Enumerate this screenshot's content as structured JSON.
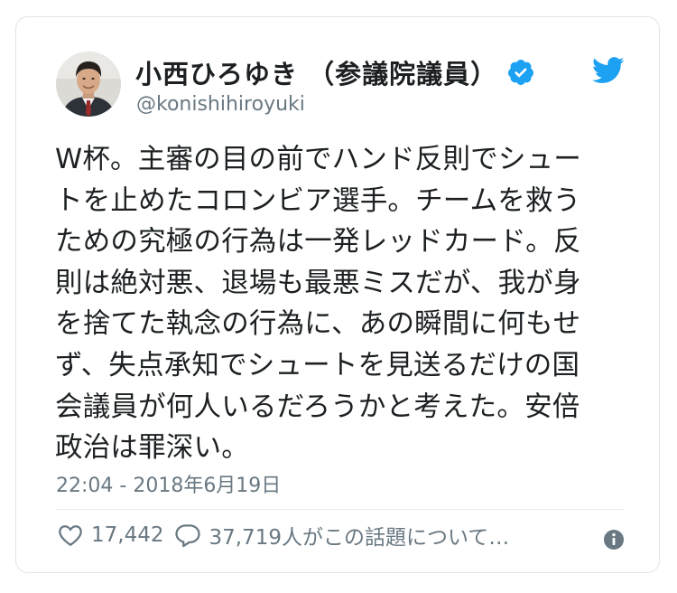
{
  "user": {
    "display_name": "小西ひろゆき （参議院議員）",
    "handle": "@konishihiroyuki",
    "avatar": "avatar-photo"
  },
  "tweet": {
    "lines": [
      "W杯。主審の目の前でハンド反則でシュー",
      "トを止めたコロンビア選手。チームを救う",
      "ための究極の行為は一発レッドカード。反",
      "則は絶対悪、退場も最悪ミスだが、我が身",
      "を捨てた執念の行為に、あの瞬間に何もせ",
      "ず、失点承知でシュートを見送るだけの国",
      "会議員が何人いるだろうかと考えた。安倍",
      "政治は罪深い。"
    ],
    "timestamp": "22:04 - 2018年6月19日"
  },
  "actions": {
    "likes": "17,442",
    "replies_text": "37,719人がこの話題について…"
  },
  "icons": {
    "verified": "verified-badge-icon",
    "logo": "twitter-bird-icon",
    "like": "heart-icon",
    "reply": "speech-bubble-icon",
    "info": "info-icon"
  },
  "colors": {
    "accent": "#1da1f2",
    "text": "#1c2022",
    "muted": "#697882",
    "border": "#dfe4e8"
  }
}
